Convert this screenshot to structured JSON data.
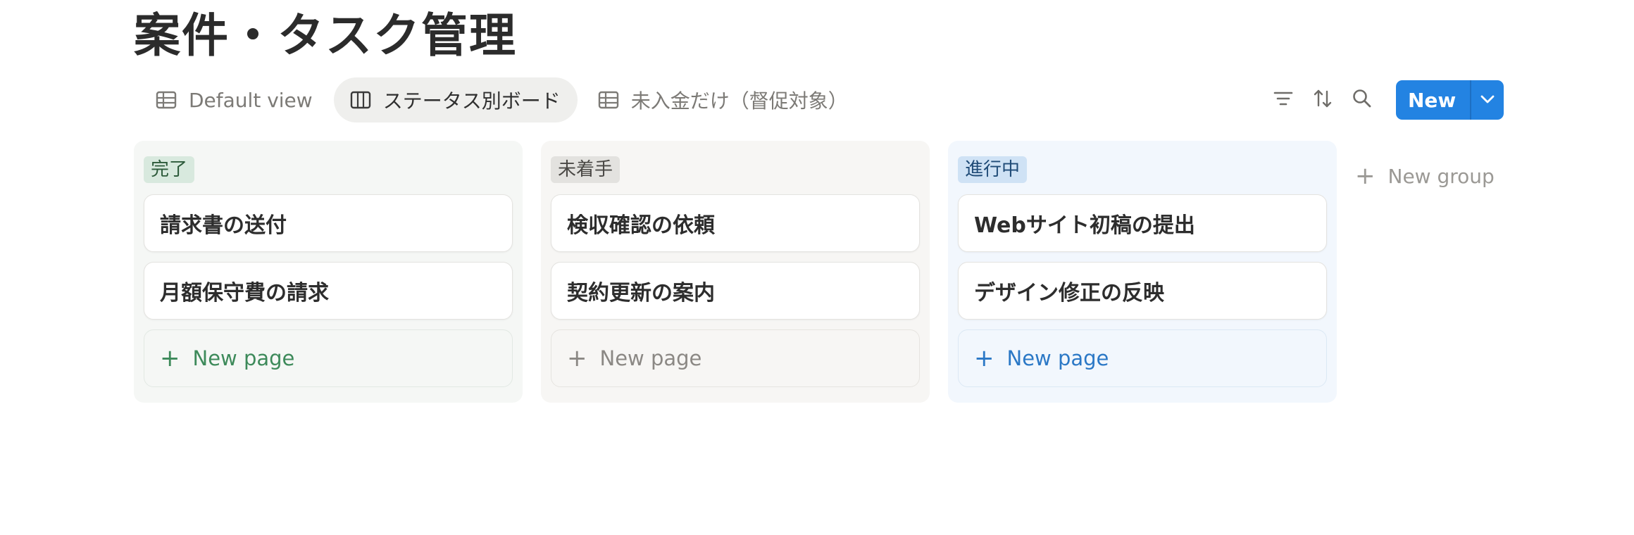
{
  "page": {
    "title": "案件・タスク管理"
  },
  "tabs": [
    {
      "label": "Default view",
      "icon": "table-icon",
      "active": false
    },
    {
      "label": "ステータス別ボード",
      "icon": "board-icon",
      "active": true
    },
    {
      "label": "未入金だけ（督促対象）",
      "icon": "table-icon",
      "active": false
    }
  ],
  "toolbar": {
    "filter_icon": "filter-icon",
    "sort_icon": "sort-icon",
    "search_icon": "search-icon",
    "new_label": "New",
    "new_caret_icon": "chevron-down-icon"
  },
  "board": {
    "groups": [
      {
        "name": "完了",
        "color": "#d8e9de",
        "cards": [
          "請求書の送付",
          "月額保守費の請求"
        ],
        "new_page_label": "New page"
      },
      {
        "name": "未着手",
        "color": "#e3e2df",
        "cards": [
          "検収確認の依頼",
          "契約更新の案内"
        ],
        "new_page_label": "New page"
      },
      {
        "name": "進行中",
        "color": "#cfe2f5",
        "cards": [
          "Webサイト初稿の提出",
          "デザイン修正の反映"
        ],
        "new_page_label": "New page"
      }
    ],
    "new_group_label": "New group"
  },
  "colors": {
    "accent": "#2383e2",
    "text": "#2f2f2f",
    "muted": "#7c7a76"
  }
}
